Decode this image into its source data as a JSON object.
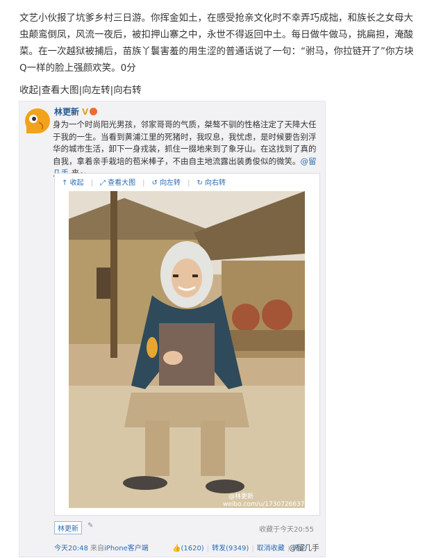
{
  "post": {
    "text": "文艺小伙报了坑爹乡村三日游。你挥金如土，在感受抢亲文化时不幸弄巧成拙，和族长之女母大虫颠鸾倒凤，风流一夜后，被扣押山寨之中，永世不得返回中土。每日做牛做马，挑扁担，淹酸菜。在一次越狱被捕后，苗族丫鬟害羞的用生涩的普通话说了一句：“驸马，你拉链开了”你方块Q一样的脸上强颜欢笑。0分",
    "actions": [
      "收起",
      "查看大图",
      "向左转",
      "向右转"
    ]
  },
  "repost": {
    "author": "林更新",
    "badge": "V",
    "text_main": "身为一个时尚阳光男孩，邻家哥哥的气质，桀骜不驯的性格注定了天降大任于我的一生。当看到黄浦江里的死猪时，我叹息，我忧虑，是时候要告别浮华的城市生活，卸下一身戎装，抓住一掇地来到了象牙山。在这找到了真的自我，拿着亲手栽培的苞米棒子，不由自主地流露出装勇俊似的微笑。",
    "mention": "@留几手",
    "text_end": " 来~",
    "image_toolbar": [
      "收起",
      "查看大图",
      "向左转",
      "向右转"
    ],
    "image_watermark_name": "@林更新",
    "image_watermark_url": "weibo.com/u/1730726637",
    "tag": "林更新",
    "fav_time": "收藏于今天20:55",
    "time": "今天20:48",
    "source_prefix": "来自",
    "source": "iPhone客户端",
    "likes": "(1620)",
    "repost_count": "转发(9349)",
    "unfav": "取消收藏",
    "comment": "评论"
  },
  "watermark": "@留几手",
  "colors": {
    "link": "#2b6bb5",
    "author": "#2b5a8a",
    "box_bg": "#f2f2f5"
  }
}
